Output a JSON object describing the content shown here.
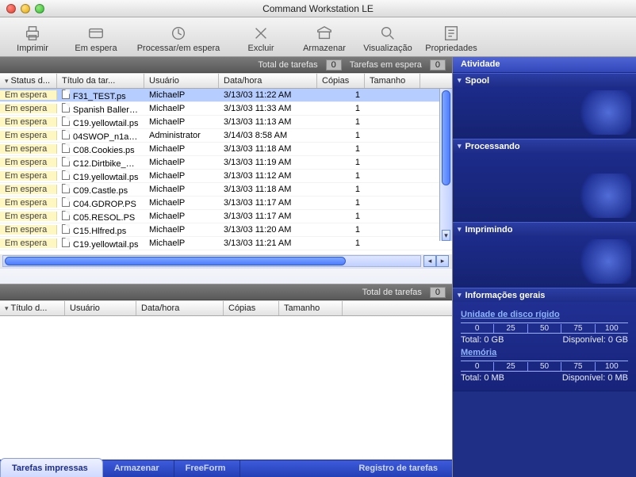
{
  "window": {
    "title": "Command Workstation LE"
  },
  "toolbar": [
    {
      "name": "print-button",
      "label": "Imprimir"
    },
    {
      "name": "hold-button",
      "label": "Em espera"
    },
    {
      "name": "process-hold-button",
      "label": "Processar/em espera",
      "wide": true
    },
    {
      "name": "delete-button",
      "label": "Excluir"
    },
    {
      "name": "archive-button",
      "label": "Armazenar"
    },
    {
      "name": "preview-button",
      "label": "Visualização"
    },
    {
      "name": "properties-button",
      "label": "Propriedades"
    }
  ],
  "upper": {
    "info": {
      "total_label": "Total de tarefas",
      "total_value": "0",
      "hold_label": "Tarefas em espera",
      "hold_value": "0"
    },
    "columns": {
      "status": "Status d...",
      "title": "Título da tar...",
      "user": "Usuário",
      "date": "Data/hora",
      "copies": "Cópias",
      "size": "Tamanho"
    },
    "rows": [
      {
        "status": "Em espera",
        "title": "F31_TEST.ps",
        "user": "MichaelP",
        "date": "3/13/03 11:22 AM",
        "copies": "1",
        "selected": true
      },
      {
        "status": "Em espera",
        "title": "Spanish Ballerin...",
        "user": "MichaelP",
        "date": "3/13/03 11:33 AM",
        "copies": "1"
      },
      {
        "status": "Em espera",
        "title": "C19.yellowtail.ps",
        "user": "MichaelP",
        "date": "3/13/03 11:13 AM",
        "copies": "1"
      },
      {
        "status": "Em espera",
        "title": "04SWOP_n1a_...",
        "user": "Administrator",
        "date": "3/14/03 8:58 AM",
        "copies": "1"
      },
      {
        "status": "Em espera",
        "title": "C08.Cookies.ps",
        "user": "MichaelP",
        "date": "3/13/03 11:18 AM",
        "copies": "1"
      },
      {
        "status": "Em espera",
        "title": "C12.Dirtbike_NO...",
        "user": "MichaelP",
        "date": "3/13/03 11:19 AM",
        "copies": "1"
      },
      {
        "status": "Em espera",
        "title": "C19.yellowtail.ps",
        "user": "MichaelP",
        "date": "3/13/03 11:12 AM",
        "copies": "1"
      },
      {
        "status": "Em espera",
        "title": "C09.Castle.ps",
        "user": "MichaelP",
        "date": "3/13/03 11:18 AM",
        "copies": "1"
      },
      {
        "status": "Em espera",
        "title": "C04.GDROP.PS",
        "user": "MichaelP",
        "date": "3/13/03 11:17 AM",
        "copies": "1"
      },
      {
        "status": "Em espera",
        "title": "C05.RESOL.PS",
        "user": "MichaelP",
        "date": "3/13/03 11:17 AM",
        "copies": "1"
      },
      {
        "status": "Em espera",
        "title": "C15.Hlfred.ps",
        "user": "MichaelP",
        "date": "3/13/03 11:20 AM",
        "copies": "1"
      },
      {
        "status": "Em espera",
        "title": "C19.yellowtail.ps",
        "user": "MichaelP",
        "date": "3/13/03 11:21 AM",
        "copies": "1"
      }
    ]
  },
  "lower": {
    "info": {
      "total_label": "Total de tarefas",
      "total_value": "0"
    },
    "columns": {
      "title": "Título d...",
      "user": "Usuário",
      "date": "Data/hora",
      "copies": "Cópias",
      "size": "Tamanho"
    }
  },
  "tabs": [
    {
      "name": "tab-printed",
      "label": "Tarefas impressas",
      "active": true
    },
    {
      "name": "tab-archive",
      "label": "Armazenar"
    },
    {
      "name": "tab-freeform",
      "label": "FreeForm"
    },
    {
      "name": "tab-joblog",
      "label": "Registro de tarefas"
    }
  ],
  "activity": {
    "title": "Atividade",
    "spool": "Spool",
    "processing": "Processando",
    "printing": "Imprimindo",
    "general": {
      "heading": "Informações gerais",
      "disk_label": "Unidade de disco rígido",
      "mem_label": "Memória",
      "ticks": [
        "0",
        "25",
        "50",
        "75",
        "100"
      ],
      "disk_total_label": "Total: 0 GB",
      "disk_avail_label": "Disponível: 0 GB",
      "mem_total_label": "Total: 0 MB",
      "mem_avail_label": "Disponível: 0 MB"
    }
  }
}
